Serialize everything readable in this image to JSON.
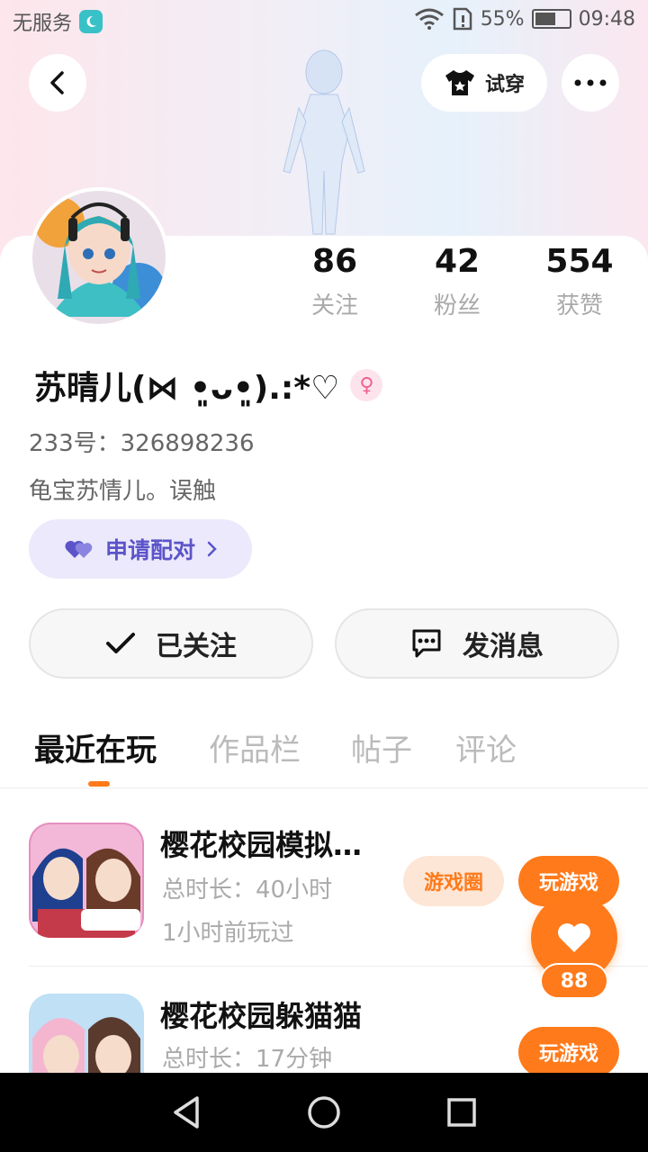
{
  "status_bar": {
    "carrier": "无服务",
    "battery": "55%",
    "time": "09:48"
  },
  "header": {
    "tryon_label": "试穿"
  },
  "profile": {
    "username": "苏晴儿(⋈ •͈ᴗ•͈).:*♡",
    "gender_symbol": "♀",
    "uid": "233号：326898236",
    "bio": "龟宝苏情儿。误触",
    "pair_label": "申请配对"
  },
  "stats": [
    {
      "value": "86",
      "label": "关注"
    },
    {
      "value": "42",
      "label": "粉丝"
    },
    {
      "value": "554",
      "label": "获赞"
    }
  ],
  "actions": {
    "followed_label": "已关注",
    "message_label": "发消息"
  },
  "tabs": [
    {
      "label": "最近在玩",
      "active": true
    },
    {
      "label": "作品栏",
      "active": false
    },
    {
      "label": "帖子",
      "active": false
    },
    {
      "label": "评论",
      "active": false
    }
  ],
  "games": [
    {
      "title": "樱花校园模拟…",
      "duration": "总时长：40小时",
      "last_played": "1小时前玩过",
      "circle_label": "游戏圈",
      "play_label": "玩游戏"
    },
    {
      "title": "樱花校园躲猫猫",
      "duration": "总时长：17分钟",
      "play_label": "玩游戏"
    }
  ],
  "like_fab": {
    "count": "88"
  },
  "colors": {
    "accent": "#ff7a1a",
    "pair_bg": "#ebe9fb",
    "pair_text": "#5b54c9"
  }
}
